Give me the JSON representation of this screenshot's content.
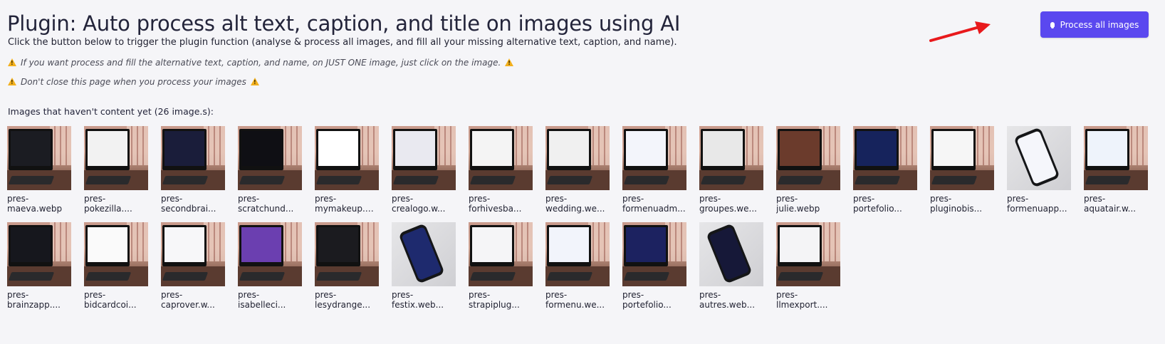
{
  "header": {
    "title": "Plugin: Auto process alt text, caption, and title on images using AI",
    "subtitle": "Click the button below to trigger the plugin function (analyse & process all images, and fill all your missing alternative text, caption, and name).",
    "note_one": "If you want process and fill the alternative text, caption, and name, on JUST ONE image, just click on the image.",
    "note_two": "Don't close this page when you process your images"
  },
  "process_button": {
    "label": "Process all images"
  },
  "images_section": {
    "label": "Images that haven't content yet (26 image.s):",
    "rows": [
      [
        {
          "line1": "pres-",
          "line2": "maeva.webp",
          "kind": "monitor",
          "screen": "#1b1c22"
        },
        {
          "line1": "pres-",
          "line2": "pokezilla....",
          "kind": "monitor",
          "screen": "#f2f2f2"
        },
        {
          "line1": "pres-",
          "line2": "secondbrai...",
          "kind": "monitor",
          "screen": "#1a1d3a"
        },
        {
          "line1": "pres-",
          "line2": "scratchund...",
          "kind": "monitor",
          "screen": "#0f0f14"
        },
        {
          "line1": "pres-",
          "line2": "mymakeup.w...",
          "kind": "monitor",
          "screen": "#ffffff"
        },
        {
          "line1": "pres-",
          "line2": "crealogo.w...",
          "kind": "monitor",
          "screen": "#e9e9f0"
        },
        {
          "line1": "pres-",
          "line2": "forhivesba...",
          "kind": "monitor",
          "screen": "#f4f4f4"
        },
        {
          "line1": "pres-",
          "line2": "wedding.we...",
          "kind": "monitor",
          "screen": "#f0f0f0"
        },
        {
          "line1": "pres-",
          "line2": "formenuadm...",
          "kind": "monitor",
          "screen": "#f3f5fb"
        },
        {
          "line1": "pres-",
          "line2": "groupes.we...",
          "kind": "monitor",
          "screen": "#e8e8e8"
        },
        {
          "line1": "pres-",
          "line2": "julie.webp",
          "kind": "monitor",
          "screen": "#6b3b2c"
        },
        {
          "line1": "pres-",
          "line2": "portefolio...",
          "kind": "monitor",
          "screen": "#16235c"
        },
        {
          "line1": "pres-",
          "line2": "pluginobis...",
          "kind": "monitor",
          "screen": "#f6f6f6"
        },
        {
          "line1": "pres-",
          "line2": "formenuapp...",
          "kind": "phone",
          "screen": "#f5f6fb"
        },
        {
          "line1": "pres-",
          "line2": "aquatair.w...",
          "kind": "monitor",
          "screen": "#eef3fb"
        }
      ],
      [
        {
          "line1": "pres-",
          "line2": "brainzapp....",
          "kind": "monitor",
          "screen": "#16171d"
        },
        {
          "line1": "pres-",
          "line2": "bidcardcoi...",
          "kind": "monitor",
          "screen": "#fafafa"
        },
        {
          "line1": "pres-",
          "line2": "caprover.w...",
          "kind": "monitor",
          "screen": "#f7f7f9"
        },
        {
          "line1": "pres-",
          "line2": "isabelleci...",
          "kind": "monitor",
          "screen": "#6b3fb0"
        },
        {
          "line1": "pres-",
          "line2": "lesydrange...",
          "kind": "monitor",
          "screen": "#1b1b1f"
        },
        {
          "line1": "pres-",
          "line2": "festix.web...",
          "kind": "phone",
          "screen": "#1e2a6e"
        },
        {
          "line1": "pres-",
          "line2": "strapiplug...",
          "kind": "monitor",
          "screen": "#f5f5f7"
        },
        {
          "line1": "pres-",
          "line2": "formenu.we...",
          "kind": "monitor",
          "screen": "#f2f4fb"
        },
        {
          "line1": "pres-",
          "line2": "portefolio...",
          "kind": "monitor",
          "screen": "#1c2260"
        },
        {
          "line1": "pres-",
          "line2": "autres.web...",
          "kind": "phone",
          "screen": "#161838"
        },
        {
          "line1": "pres-",
          "line2": "llmexport....",
          "kind": "monitor",
          "screen": "#f4f4f6"
        }
      ]
    ]
  },
  "colors": {
    "accent": "#5a48ef",
    "arrow": "#e8191c",
    "warning": "#f2b01e",
    "background": "#f5f5f8"
  },
  "icons": {
    "warning": "warning-icon",
    "bell": "bell-icon",
    "arrow": "red-arrow-icon"
  }
}
